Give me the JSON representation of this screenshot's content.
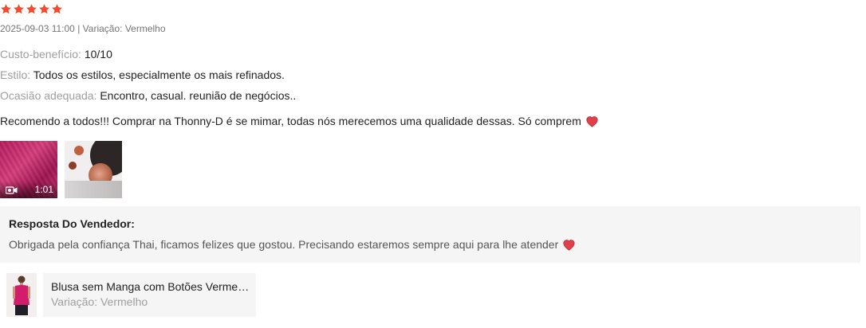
{
  "review": {
    "rating": 5,
    "max_rating": 5,
    "star_color": "#ee4d2d",
    "date": "2025-09-03 11:00",
    "separator": "|",
    "variation_label": "Variação:",
    "variation_value": "Vermelho",
    "attributes": [
      {
        "key": "Custo-benefício:",
        "value": "10/10"
      },
      {
        "key": "Estilo:",
        "value": "Todos os estilos, especialmente os mais refinados."
      },
      {
        "key": "Ocasião adequada:",
        "value": "Encontro, casual. reunião de negócios.."
      }
    ],
    "comment": "Recomendo a todos!!! Comprar na Thonny-D é se mimar, todas nós merecemos uma qualidade dessas. Só comprem",
    "comment_emoji": "heart-icon",
    "media": [
      {
        "type": "video",
        "duration": "1:01",
        "icon": "video-camera-icon"
      },
      {
        "type": "image"
      }
    ]
  },
  "seller_reply": {
    "title": "Resposta Do Vendedor:",
    "text": "Obrigada pela confiança Thai, ficamos felizes que gostou. Precisando estaremos sempre aqui para lhe atender",
    "emoji": "heart-icon"
  },
  "product": {
    "name": "Blusa sem Manga com Botões Vermelho",
    "variation": "Variação: Vermelho"
  }
}
